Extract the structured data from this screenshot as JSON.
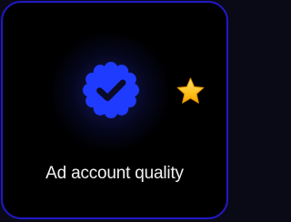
{
  "card": {
    "label": "Ad account quality",
    "icon": "verified-badge-icon",
    "accessory_icon": "star-icon"
  },
  "colors": {
    "background": "#000000",
    "border": "#2218c8",
    "badge": "#1f3bff",
    "check": "#0a0a2a",
    "star": "#ffc21a",
    "text": "#f2f2f2"
  }
}
